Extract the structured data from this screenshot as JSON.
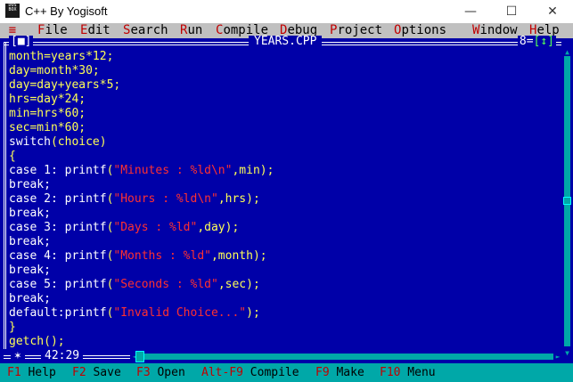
{
  "window": {
    "title": "C++ By Yogisoft",
    "app_icon_text": "DOS\nBOX",
    "minimize": "—",
    "maximize": "☐",
    "close": "✕"
  },
  "menu": {
    "system": "≡",
    "items": [
      {
        "hotkey": "F",
        "rest": "ile"
      },
      {
        "hotkey": "E",
        "rest": "dit"
      },
      {
        "hotkey": "S",
        "rest": "earch"
      },
      {
        "hotkey": "R",
        "rest": "un"
      },
      {
        "hotkey": "C",
        "rest": "ompile"
      },
      {
        "hotkey": "D",
        "rest": "ebug"
      },
      {
        "hotkey": "P",
        "rest": "roject"
      },
      {
        "hotkey": "O",
        "rest": "ptions"
      },
      {
        "hotkey": "W",
        "rest": "indow"
      },
      {
        "hotkey": "H",
        "rest": "elp"
      }
    ]
  },
  "editor": {
    "close_box": "[■]",
    "filename": "YEARS.CPP",
    "window_number": "8",
    "zoom_box": "[↕]",
    "cursor_position": "42:29",
    "lines": [
      [
        {
          "t": "month=years*12;",
          "c": "y"
        }
      ],
      [
        {
          "t": "day=month*30;",
          "c": "y"
        }
      ],
      [
        {
          "t": "day=day+years*5;",
          "c": "y"
        }
      ],
      [
        {
          "t": "hrs=day*24;",
          "c": "y"
        }
      ],
      [
        {
          "t": "min=hrs*60;",
          "c": "y"
        }
      ],
      [
        {
          "t": "sec=min*60;",
          "c": "y"
        }
      ],
      [
        {
          "t": "switch",
          "c": "w"
        },
        {
          "t": "(choice)",
          "c": "y"
        }
      ],
      [
        {
          "t": "{",
          "c": "y"
        }
      ],
      [
        {
          "t": "case 1: printf",
          "c": "w"
        },
        {
          "t": "(",
          "c": "y"
        },
        {
          "t": "\"Minutes : %ld\\n\"",
          "c": "r"
        },
        {
          "t": ",min);",
          "c": "y"
        }
      ],
      [
        {
          "t": "break;",
          "c": "w"
        }
      ],
      [
        {
          "t": "case 2: printf",
          "c": "w"
        },
        {
          "t": "(",
          "c": "y"
        },
        {
          "t": "\"Hours : %ld\\n\"",
          "c": "r"
        },
        {
          "t": ",hrs);",
          "c": "y"
        }
      ],
      [
        {
          "t": "break;",
          "c": "w"
        }
      ],
      [
        {
          "t": "case 3: printf",
          "c": "w"
        },
        {
          "t": "(",
          "c": "y"
        },
        {
          "t": "\"Days : %ld\"",
          "c": "r"
        },
        {
          "t": ",day);",
          "c": "y"
        }
      ],
      [
        {
          "t": "break;",
          "c": "w"
        }
      ],
      [
        {
          "t": "case 4: printf",
          "c": "w"
        },
        {
          "t": "(",
          "c": "y"
        },
        {
          "t": "\"Months : %ld\"",
          "c": "r"
        },
        {
          "t": ",month);",
          "c": "y"
        }
      ],
      [
        {
          "t": "break;",
          "c": "w"
        }
      ],
      [
        {
          "t": "case 5: printf",
          "c": "w"
        },
        {
          "t": "(",
          "c": "y"
        },
        {
          "t": "\"Seconds : %ld\"",
          "c": "r"
        },
        {
          "t": ",sec);",
          "c": "y"
        }
      ],
      [
        {
          "t": "break;",
          "c": "w"
        }
      ],
      [
        {
          "t": "default:printf",
          "c": "w"
        },
        {
          "t": "(",
          "c": "y"
        },
        {
          "t": "\"Invalid Choice...\"",
          "c": "r"
        },
        {
          "t": ");",
          "c": "y"
        }
      ],
      [
        {
          "t": "}",
          "c": "y"
        }
      ],
      [
        {
          "t": "getch();",
          "c": "y"
        }
      ]
    ]
  },
  "statusbar": {
    "items": [
      {
        "key": "F1",
        "label": " Help"
      },
      {
        "key": "F2",
        "label": " Save"
      },
      {
        "key": "F3",
        "label": " Open"
      },
      {
        "key": "Alt-F9",
        "label": " Compile"
      },
      {
        "key": "F9",
        "label": " Make"
      },
      {
        "key": "F10",
        "label": " Menu"
      }
    ]
  },
  "colors": {
    "editor_bg": "#0000a8",
    "menubar_bg": "#c0c0c0",
    "statusbar_bg": "#00a8a8",
    "hotkey": "#c00000",
    "code_yellow": "#ffff55",
    "code_white": "#ffffff",
    "code_string": "#ff3030"
  }
}
